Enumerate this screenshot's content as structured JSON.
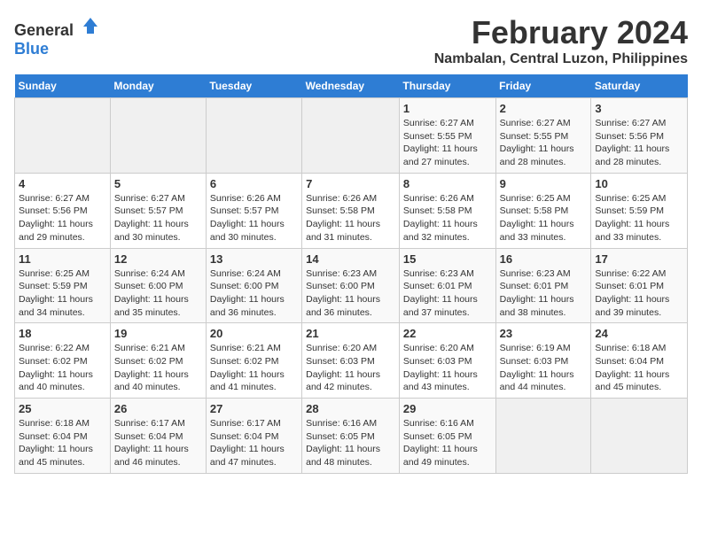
{
  "logo": {
    "general": "General",
    "blue": "Blue"
  },
  "title": "February 2024",
  "location": "Nambalan, Central Luzon, Philippines",
  "days_header": [
    "Sunday",
    "Monday",
    "Tuesday",
    "Wednesday",
    "Thursday",
    "Friday",
    "Saturday"
  ],
  "weeks": [
    [
      {
        "num": "",
        "detail": ""
      },
      {
        "num": "",
        "detail": ""
      },
      {
        "num": "",
        "detail": ""
      },
      {
        "num": "",
        "detail": ""
      },
      {
        "num": "1",
        "detail": "Sunrise: 6:27 AM\nSunset: 5:55 PM\nDaylight: 11 hours and 27 minutes."
      },
      {
        "num": "2",
        "detail": "Sunrise: 6:27 AM\nSunset: 5:55 PM\nDaylight: 11 hours and 28 minutes."
      },
      {
        "num": "3",
        "detail": "Sunrise: 6:27 AM\nSunset: 5:56 PM\nDaylight: 11 hours and 28 minutes."
      }
    ],
    [
      {
        "num": "4",
        "detail": "Sunrise: 6:27 AM\nSunset: 5:56 PM\nDaylight: 11 hours and 29 minutes."
      },
      {
        "num": "5",
        "detail": "Sunrise: 6:27 AM\nSunset: 5:57 PM\nDaylight: 11 hours and 30 minutes."
      },
      {
        "num": "6",
        "detail": "Sunrise: 6:26 AM\nSunset: 5:57 PM\nDaylight: 11 hours and 30 minutes."
      },
      {
        "num": "7",
        "detail": "Sunrise: 6:26 AM\nSunset: 5:58 PM\nDaylight: 11 hours and 31 minutes."
      },
      {
        "num": "8",
        "detail": "Sunrise: 6:26 AM\nSunset: 5:58 PM\nDaylight: 11 hours and 32 minutes."
      },
      {
        "num": "9",
        "detail": "Sunrise: 6:25 AM\nSunset: 5:58 PM\nDaylight: 11 hours and 33 minutes."
      },
      {
        "num": "10",
        "detail": "Sunrise: 6:25 AM\nSunset: 5:59 PM\nDaylight: 11 hours and 33 minutes."
      }
    ],
    [
      {
        "num": "11",
        "detail": "Sunrise: 6:25 AM\nSunset: 5:59 PM\nDaylight: 11 hours and 34 minutes."
      },
      {
        "num": "12",
        "detail": "Sunrise: 6:24 AM\nSunset: 6:00 PM\nDaylight: 11 hours and 35 minutes."
      },
      {
        "num": "13",
        "detail": "Sunrise: 6:24 AM\nSunset: 6:00 PM\nDaylight: 11 hours and 36 minutes."
      },
      {
        "num": "14",
        "detail": "Sunrise: 6:23 AM\nSunset: 6:00 PM\nDaylight: 11 hours and 36 minutes."
      },
      {
        "num": "15",
        "detail": "Sunrise: 6:23 AM\nSunset: 6:01 PM\nDaylight: 11 hours and 37 minutes."
      },
      {
        "num": "16",
        "detail": "Sunrise: 6:23 AM\nSunset: 6:01 PM\nDaylight: 11 hours and 38 minutes."
      },
      {
        "num": "17",
        "detail": "Sunrise: 6:22 AM\nSunset: 6:01 PM\nDaylight: 11 hours and 39 minutes."
      }
    ],
    [
      {
        "num": "18",
        "detail": "Sunrise: 6:22 AM\nSunset: 6:02 PM\nDaylight: 11 hours and 40 minutes."
      },
      {
        "num": "19",
        "detail": "Sunrise: 6:21 AM\nSunset: 6:02 PM\nDaylight: 11 hours and 40 minutes."
      },
      {
        "num": "20",
        "detail": "Sunrise: 6:21 AM\nSunset: 6:02 PM\nDaylight: 11 hours and 41 minutes."
      },
      {
        "num": "21",
        "detail": "Sunrise: 6:20 AM\nSunset: 6:03 PM\nDaylight: 11 hours and 42 minutes."
      },
      {
        "num": "22",
        "detail": "Sunrise: 6:20 AM\nSunset: 6:03 PM\nDaylight: 11 hours and 43 minutes."
      },
      {
        "num": "23",
        "detail": "Sunrise: 6:19 AM\nSunset: 6:03 PM\nDaylight: 11 hours and 44 minutes."
      },
      {
        "num": "24",
        "detail": "Sunrise: 6:18 AM\nSunset: 6:04 PM\nDaylight: 11 hours and 45 minutes."
      }
    ],
    [
      {
        "num": "25",
        "detail": "Sunrise: 6:18 AM\nSunset: 6:04 PM\nDaylight: 11 hours and 45 minutes."
      },
      {
        "num": "26",
        "detail": "Sunrise: 6:17 AM\nSunset: 6:04 PM\nDaylight: 11 hours and 46 minutes."
      },
      {
        "num": "27",
        "detail": "Sunrise: 6:17 AM\nSunset: 6:04 PM\nDaylight: 11 hours and 47 minutes."
      },
      {
        "num": "28",
        "detail": "Sunrise: 6:16 AM\nSunset: 6:05 PM\nDaylight: 11 hours and 48 minutes."
      },
      {
        "num": "29",
        "detail": "Sunrise: 6:16 AM\nSunset: 6:05 PM\nDaylight: 11 hours and 49 minutes."
      },
      {
        "num": "",
        "detail": ""
      },
      {
        "num": "",
        "detail": ""
      }
    ]
  ]
}
